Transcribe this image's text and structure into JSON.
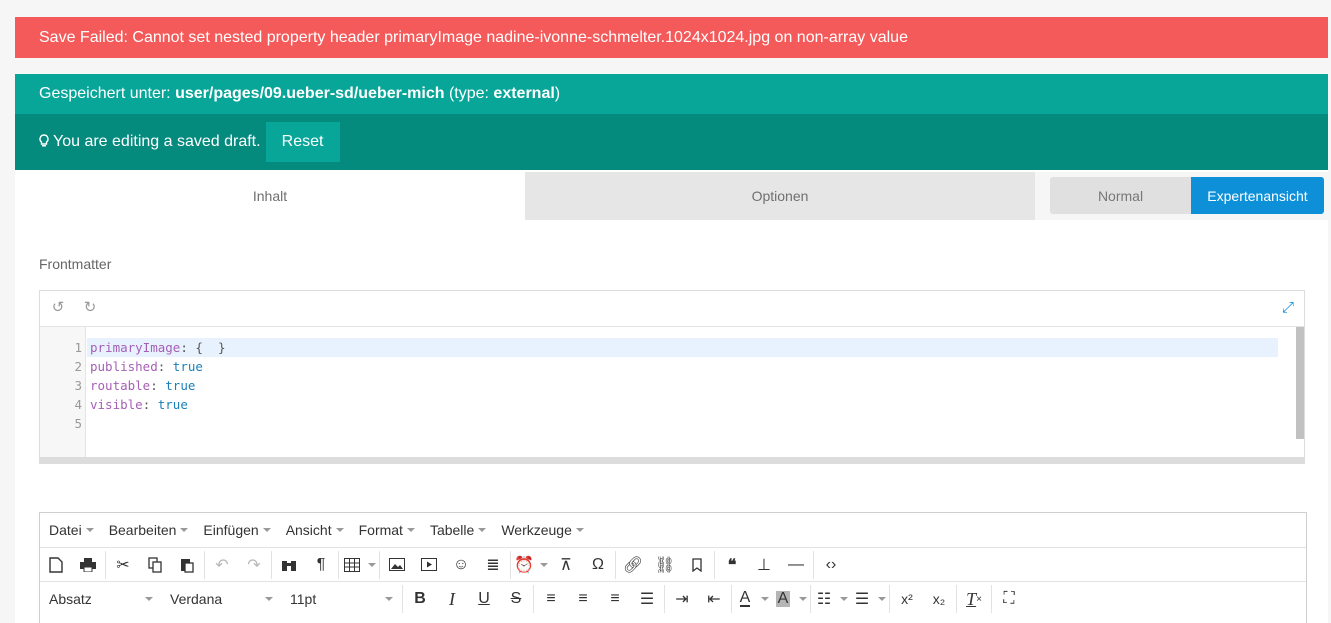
{
  "error": {
    "text": "Save Failed: Cannot set nested property header primaryImage nadine-ivonne-schmelter.1024x1024.jpg on non-array value"
  },
  "saved": {
    "prefix": "Gespeichert unter: ",
    "path": "user/pages/09.ueber-sd/ueber-mich",
    "type_prefix": " (type: ",
    "type": "external",
    "type_suffix": ")"
  },
  "draft": {
    "text": "You are editing a saved draft.",
    "reset_label": "Reset"
  },
  "tabs": [
    {
      "label": "Inhalt"
    },
    {
      "label": "Optionen"
    }
  ],
  "view_toggle": {
    "normal": "Normal",
    "expert": "Expertenansicht"
  },
  "frontmatter": {
    "label": "Frontmatter",
    "lines": [
      {
        "n": "1",
        "key": "primaryImage",
        "sep": ": ",
        "val": "{  }"
      },
      {
        "n": "2",
        "key": "published",
        "sep": ": ",
        "val": "true"
      },
      {
        "n": "3",
        "key": "routable",
        "sep": ": ",
        "val": "true"
      },
      {
        "n": "4",
        "key": "visible",
        "sep": ": ",
        "val": "true"
      },
      {
        "n": "5",
        "key": "",
        "sep": "",
        "val": ""
      }
    ]
  },
  "editor": {
    "menu": [
      "Datei",
      "Bearbeiten",
      "Einfügen",
      "Ansicht",
      "Format",
      "Tabelle",
      "Werkzeuge"
    ],
    "format_select": "Absatz",
    "font_select": "Verdana",
    "size_select": "11pt"
  },
  "colors": {
    "error": "#f55a5a",
    "saved": "#07a699",
    "draft": "#058a7e",
    "accent": "#0e90d9"
  }
}
